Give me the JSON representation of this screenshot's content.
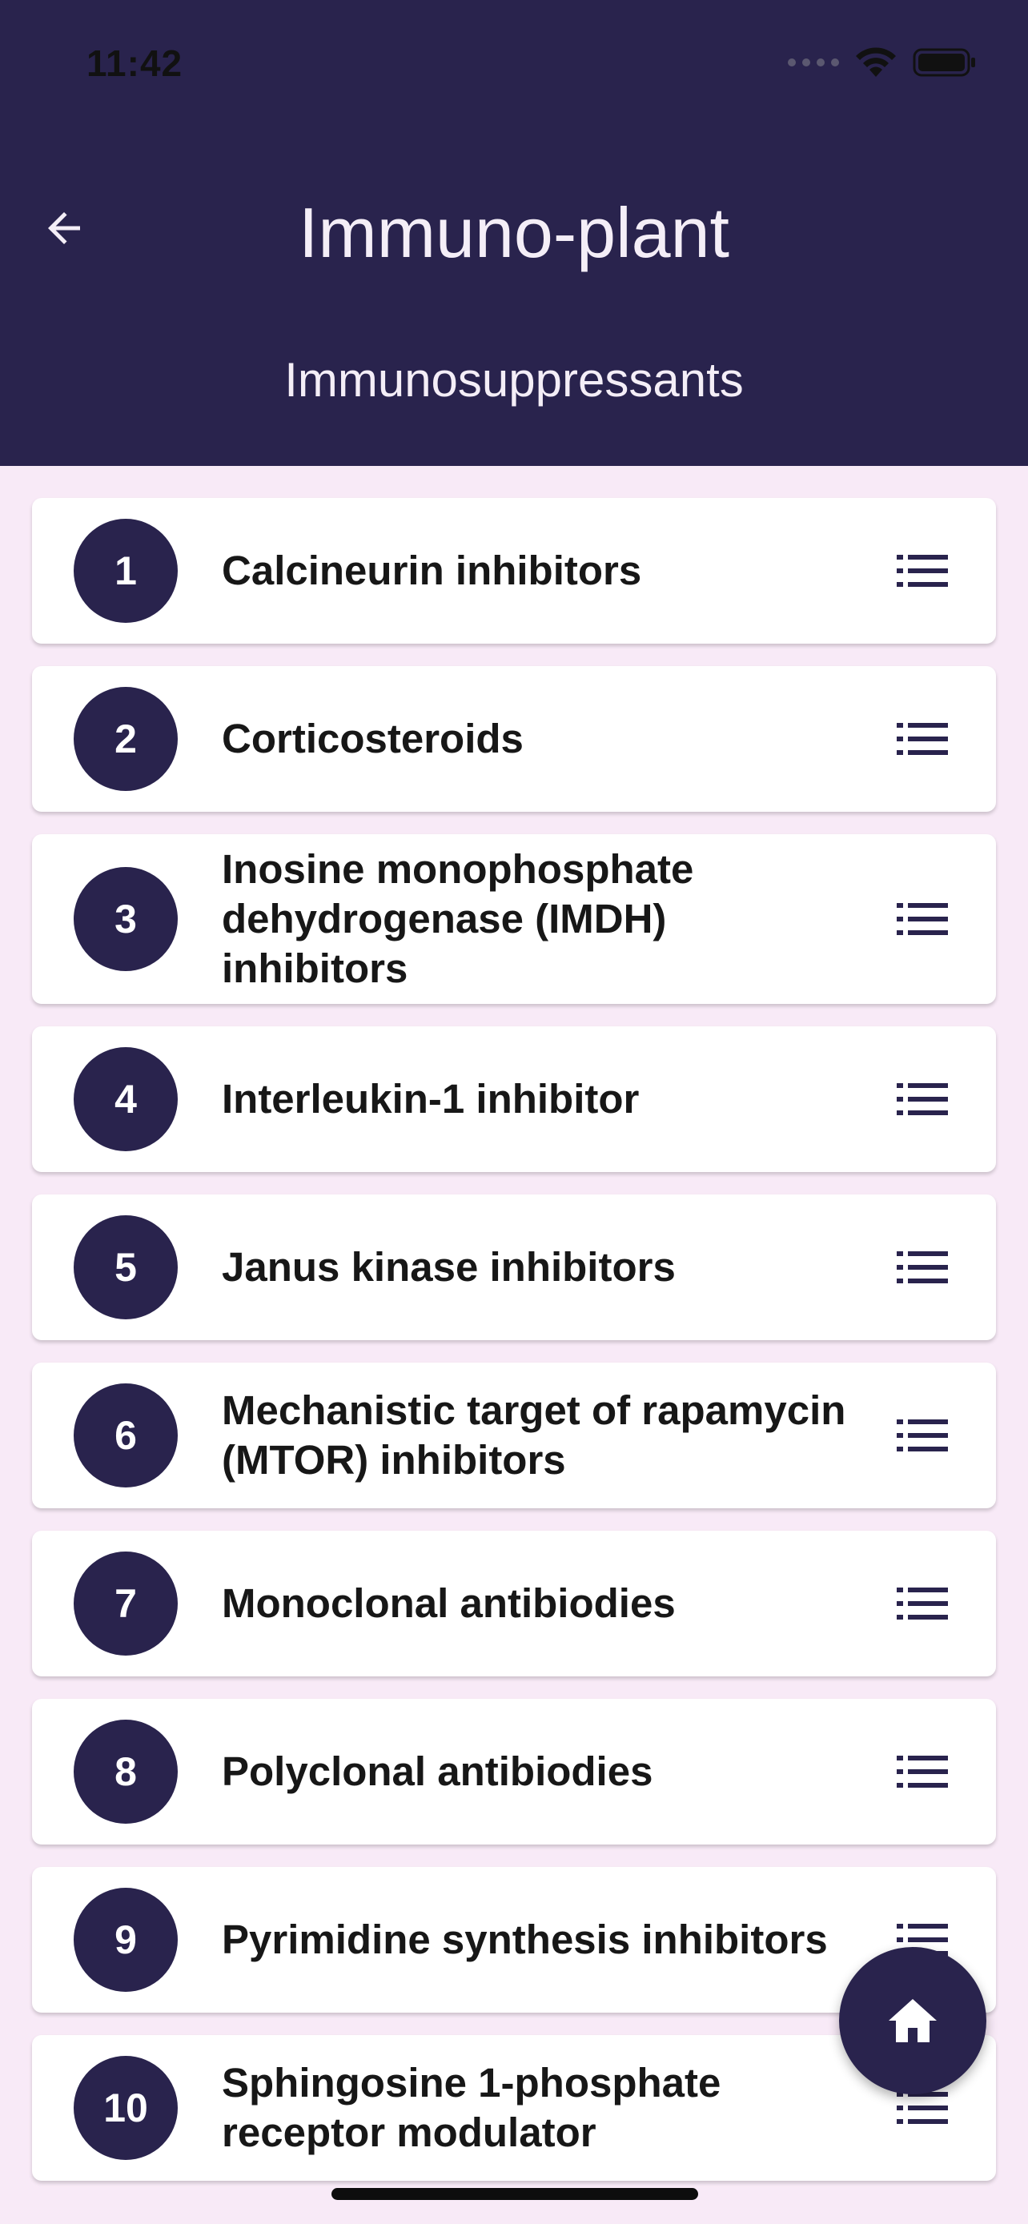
{
  "status_bar": {
    "time": "11:42",
    "icons": [
      "signal-dots-icon",
      "wifi-icon",
      "battery-icon"
    ]
  },
  "header": {
    "title": "Immuno-plant",
    "subtitle": "Immunosuppressants",
    "back_icon": "arrow-left-icon"
  },
  "items": [
    {
      "number": "1",
      "label": "Calcineurin inhibitors"
    },
    {
      "number": "2",
      "label": "Corticosteroids"
    },
    {
      "number": "3",
      "label": "Inosine monophosphate dehydrogenase (IMDH) inhibitors"
    },
    {
      "number": "4",
      "label": "Interleukin-1 inhibitor"
    },
    {
      "number": "5",
      "label": "Janus kinase inhibitors"
    },
    {
      "number": "6",
      "label": "Mechanistic target of rapamycin (MTOR) inhibitors"
    },
    {
      "number": "7",
      "label": "Monoclonal antibiodies"
    },
    {
      "number": "8",
      "label": "Polyclonal antibiodies"
    },
    {
      "number": "9",
      "label": "Pyrimidine synthesis inhibitors"
    },
    {
      "number": "10",
      "label": "Sphingosine 1-phosphate receptor modulator"
    }
  ],
  "fab": {
    "icon": "home-icon"
  },
  "colors": {
    "primary": "#29234d",
    "background": "#f8eaf7",
    "card": "#ffffff"
  }
}
